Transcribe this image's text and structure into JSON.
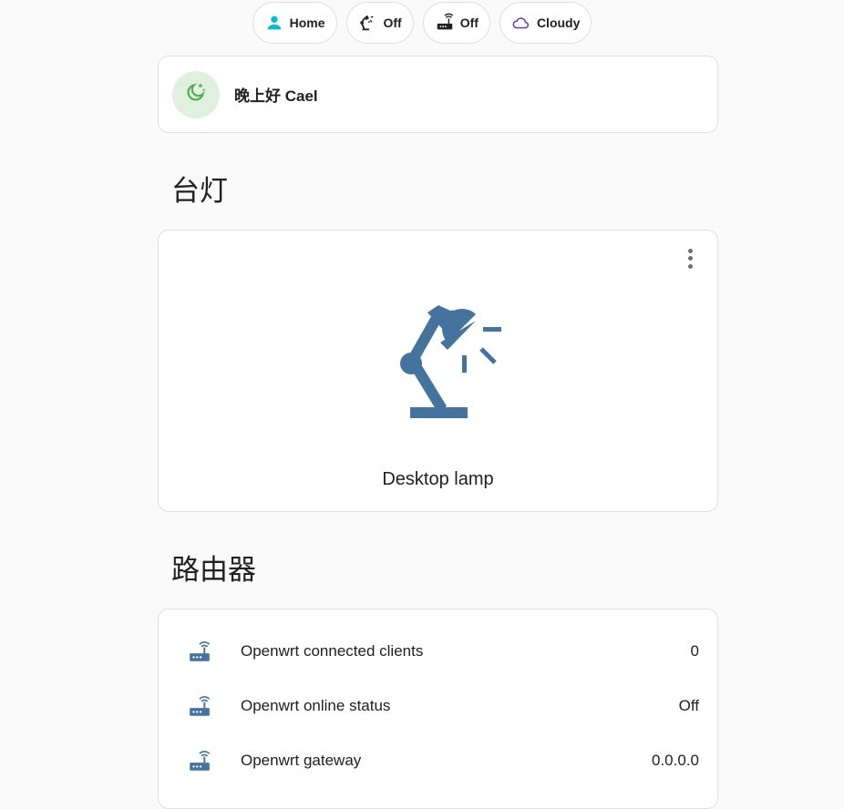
{
  "chips": [
    {
      "name": "person",
      "icon": "person-icon",
      "label": "Home",
      "color": "#03a9f4"
    },
    {
      "name": "lamp",
      "icon": "desk-lamp-icon",
      "label": "Off",
      "color": "#212121"
    },
    {
      "name": "router",
      "icon": "router-icon",
      "label": "Off",
      "color": "#212121"
    },
    {
      "name": "weather",
      "icon": "cloud-icon",
      "label": "Cloudy",
      "color": "#673ab7"
    }
  ],
  "greeting": {
    "icon": "moon-stars-icon",
    "text": "晚上好 Cael",
    "badge_color": "#dff0df",
    "icon_color": "#4caf50"
  },
  "sections": {
    "lamp_title": "台灯",
    "router_title": "路由器"
  },
  "lamp_card": {
    "name": "Desktop lamp",
    "icon": "desk-lamp-icon",
    "icon_color": "#44739e",
    "menu_icon": "more-vertical-icon"
  },
  "router_rows": [
    {
      "icon": "router-icon",
      "label": "Openwrt connected clients",
      "value": "0"
    },
    {
      "icon": "router-icon",
      "label": "Openwrt online status",
      "value": "Off"
    },
    {
      "icon": "router-icon",
      "label": "Openwrt gateway",
      "value": "0.0.0.0"
    }
  ],
  "colors": {
    "accent_blue": "#44739e",
    "background": "#fafafa",
    "card_border": "#e0e0e0"
  }
}
